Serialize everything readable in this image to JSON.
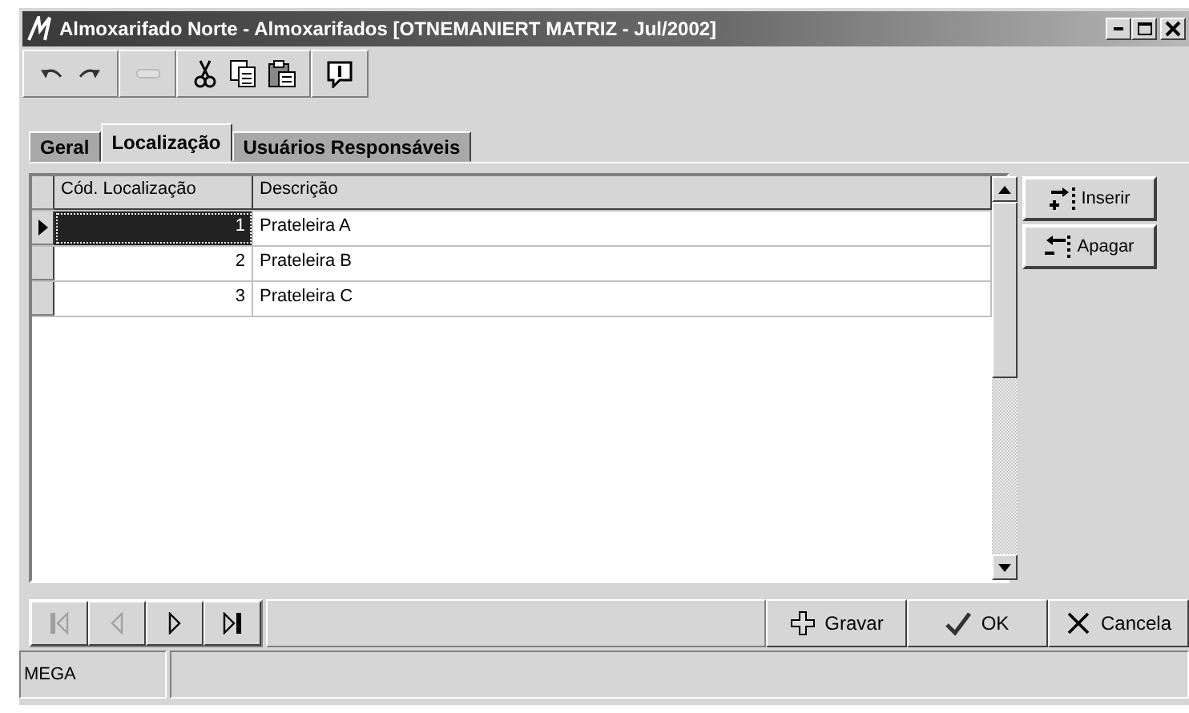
{
  "window": {
    "title": "Almoxarifado Norte -  Almoxarifados [OTNEMANIERT MATRIZ - Jul/2002]"
  },
  "toolbar": [
    {
      "kind": "undo",
      "disabled": false
    },
    {
      "kind": "redo",
      "disabled": false
    },
    {
      "kind": "minus",
      "disabled": true
    },
    {
      "kind": "cut",
      "disabled": false
    },
    {
      "kind": "copy",
      "disabled": false
    },
    {
      "kind": "paste",
      "disabled": false
    },
    {
      "kind": "info",
      "disabled": false
    }
  ],
  "tabs": [
    {
      "label": "Geral",
      "selected": false
    },
    {
      "label": "Localização",
      "selected": true
    },
    {
      "label": "Usuários Responsáveis",
      "selected": false
    }
  ],
  "table": {
    "columns": [
      "Cód. Localização",
      "Descrição"
    ],
    "rows": [
      {
        "cells": [
          "1",
          "Prateleira A"
        ],
        "selected": true
      },
      {
        "cells": [
          "2",
          "Prateleira B"
        ],
        "selected": false
      },
      {
        "cells": [
          "3",
          "Prateleira C"
        ],
        "selected": false
      }
    ]
  },
  "side_buttons": [
    {
      "kind": "insert",
      "label": "Inserir"
    },
    {
      "kind": "delete",
      "label": "Apagar"
    }
  ],
  "navigator": [
    {
      "kind": "first",
      "disabled": true
    },
    {
      "kind": "prior",
      "disabled": true
    },
    {
      "kind": "next",
      "disabled": false
    },
    {
      "kind": "last",
      "disabled": false
    }
  ],
  "action_buttons": [
    {
      "kind": "save",
      "label": "Gravar"
    },
    {
      "kind": "ok",
      "label": "OK"
    },
    {
      "kind": "cancel",
      "label": "Cancela"
    }
  ],
  "status_bar": {
    "panels": [
      "MEGA"
    ]
  }
}
